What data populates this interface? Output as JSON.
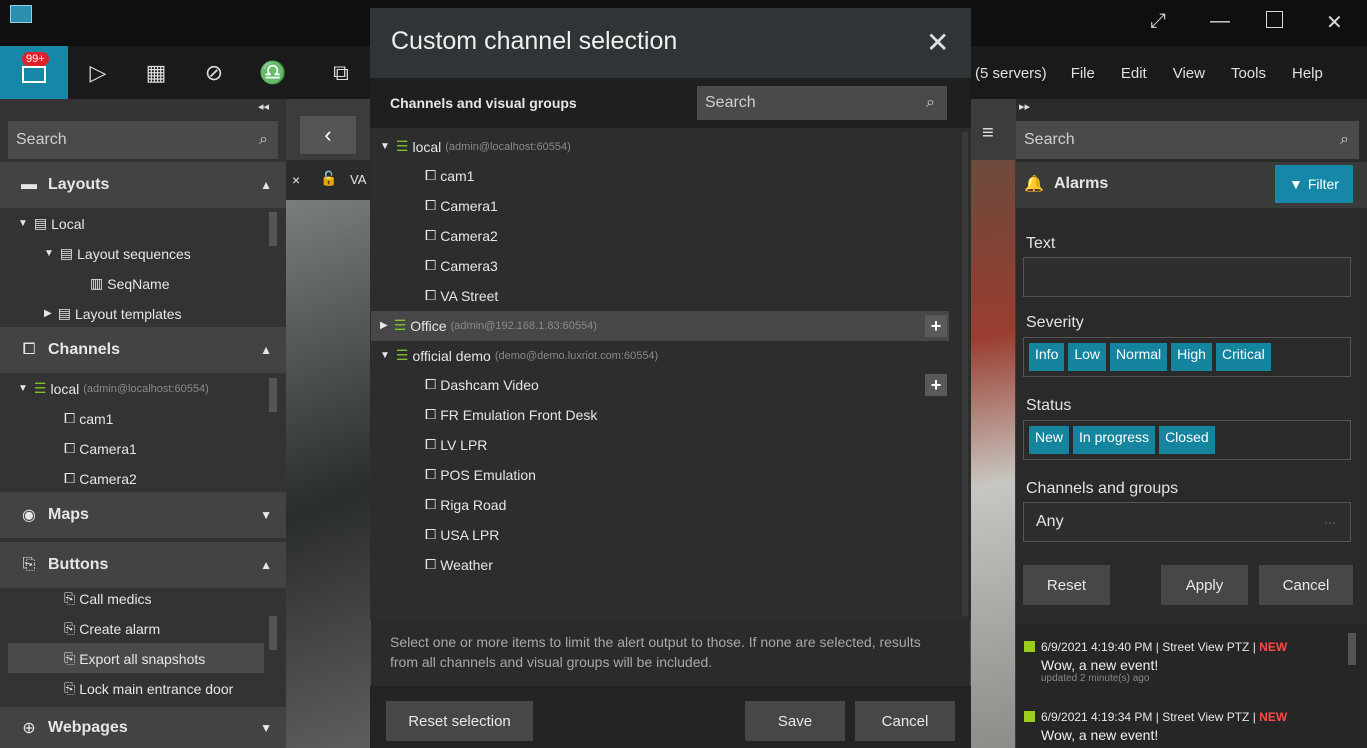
{
  "titlebar": {
    "icons": [
      "app-monitor-icon",
      "expand-icon",
      "minimize-icon",
      "maximize-icon",
      "close-icon"
    ]
  },
  "toolbar": {
    "badge": "99+",
    "servers": "(5 servers)",
    "menu": [
      "File",
      "Edit",
      "View",
      "Tools",
      "Help"
    ]
  },
  "left_panel": {
    "search_placeholder": "Search",
    "layouts": {
      "title": "Layouts",
      "items": [
        {
          "label": "Local"
        },
        {
          "label": "Layout sequences"
        },
        {
          "label": "SeqName"
        },
        {
          "label": "Layout templates"
        }
      ]
    },
    "channels": {
      "title": "Channels",
      "server": "local",
      "server_sub": "(admin@localhost:60554)",
      "items": [
        "cam1",
        "Camera1",
        "Camera2"
      ]
    },
    "maps": {
      "title": "Maps"
    },
    "buttons": {
      "title": "Buttons",
      "items": [
        "Call medics",
        "Create alarm",
        "Export all snapshots",
        "Lock main entrance door"
      ]
    },
    "webpages": {
      "title": "Webpages"
    }
  },
  "video": {
    "tab_close": "×",
    "tab_label": "VA"
  },
  "modal": {
    "title": "Custom channel selection",
    "subtitle": "Channels and visual groups",
    "search_placeholder": "Search",
    "groups": [
      {
        "name": "local",
        "sub": "(admin@localhost:60554)",
        "expanded": true,
        "items": [
          "cam1",
          "Camera1",
          "Camera2",
          "Camera3",
          "VA Street"
        ]
      },
      {
        "name": "Office",
        "sub": "(admin@192.168.1.83:60554)",
        "expanded": false,
        "items": []
      },
      {
        "name": "official demo",
        "sub": "(demo@demo.luxriot.com:60554)",
        "expanded": true,
        "items": [
          "Dashcam Video",
          "FR Emulation Front Desk",
          "LV LPR",
          "POS Emulation",
          "Riga Road",
          "USA LPR",
          "Weather"
        ]
      }
    ],
    "hint": "Select one or more items to limit the alert output to those. If none are selected, results from all channels and visual groups will be included.",
    "reset_label": "Reset selection",
    "save_label": "Save",
    "cancel_label": "Cancel"
  },
  "right_panel": {
    "search_placeholder": "Search",
    "title": "Alarms",
    "filter_label": "Filter",
    "text_label": "Text",
    "severity_label": "Severity",
    "severity": [
      "Info",
      "Low",
      "Normal",
      "High",
      "Critical"
    ],
    "status_label": "Status",
    "status": [
      "New",
      "In progress",
      "Closed"
    ],
    "channels_label": "Channels and groups",
    "channels_value": "Any",
    "channels_more": "···",
    "reset_label": "Reset",
    "apply_label": "Apply",
    "cancel_label": "Cancel",
    "events": [
      {
        "time": "6/9/2021 4:19:40 PM",
        "source": "Street View PTZ",
        "state": "NEW",
        "message": "Wow, a new event!",
        "updated": "updated 2 minute(s) ago"
      },
      {
        "time": "6/9/2021 4:19:34 PM",
        "source": "Street View PTZ",
        "state": "NEW",
        "message": "Wow, a new event!",
        "updated": ""
      }
    ]
  },
  "colors": {
    "accent": "#1687a7",
    "badge": "#e0202a",
    "new_status": "#ff4a4a",
    "event_marker": "#9acd1e"
  }
}
